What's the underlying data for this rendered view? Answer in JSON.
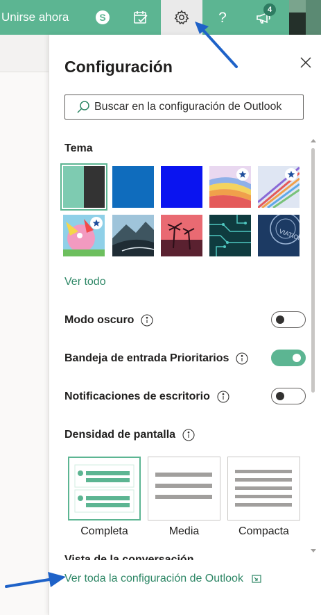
{
  "header": {
    "join_now": "Unirse ahora",
    "icons": [
      "skype-icon",
      "calendar-check-icon",
      "gear-icon",
      "help-icon",
      "megaphone-icon"
    ],
    "notifications_count": "4",
    "bar_color": "#5cb592"
  },
  "panel": {
    "title": "Configuración",
    "search_placeholder": "Buscar en la configuración de Outlook",
    "theme_section": "Tema",
    "themes": [
      {
        "name": "Verde (seleccionado)"
      },
      {
        "name": "Azul"
      },
      {
        "name": "Azul intenso"
      },
      {
        "name": "Arco iris"
      },
      {
        "name": "Circuito de colores"
      },
      {
        "name": "Dibujo"
      },
      {
        "name": "Montañas"
      },
      {
        "name": "Palmeras al atardecer"
      },
      {
        "name": "Circuitos"
      },
      {
        "name": "Aviación"
      }
    ],
    "see_all": "Ver todo",
    "dark_mode": {
      "label": "Modo oscuro",
      "on": false
    },
    "focused_inbox": {
      "label": "Bandeja de entrada Prioritarios",
      "on": true
    },
    "desktop_notifications": {
      "label": "Notificaciones de escritorio",
      "on": false
    },
    "density_section": "Densidad de pantalla",
    "density_options": [
      {
        "label": "Completa",
        "selected": true
      },
      {
        "label": "Media",
        "selected": false
      },
      {
        "label": "Compacta",
        "selected": false
      }
    ],
    "next_section_clipped": "Vista de la conversación",
    "view_all_settings": "Ver toda la configuración de Outlook"
  },
  "colors": {
    "accent": "#5cb592",
    "link": "#2e8766",
    "annotation_arrow": "#1e62c8"
  }
}
